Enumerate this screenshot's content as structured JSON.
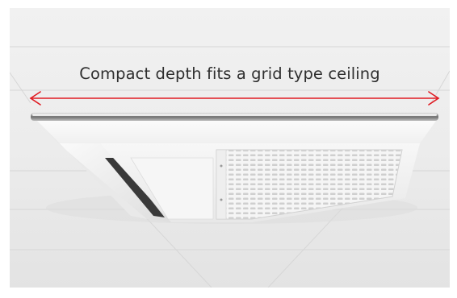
{
  "caption": {
    "text": "Compact depth fits a grid type ceiling"
  },
  "colors": {
    "measure_arrow": "#e01b22",
    "ceiling": "#eaeaea",
    "unit_body": "#f6f6f6"
  },
  "icons": {
    "arrow": "double-headed-arrow-icon"
  }
}
